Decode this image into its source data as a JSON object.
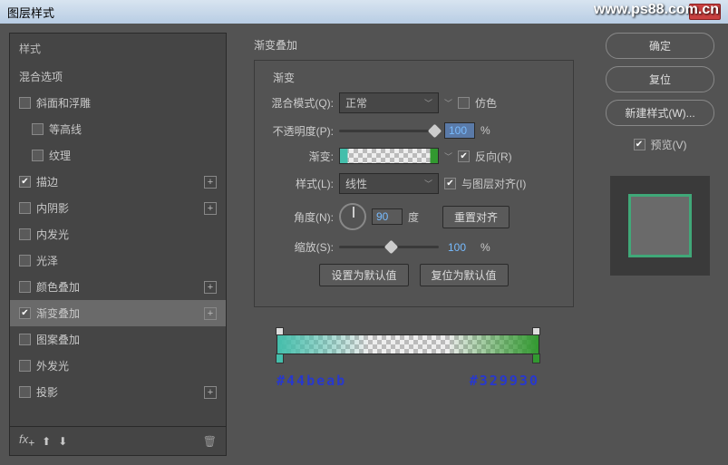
{
  "window": {
    "title": "图层样式"
  },
  "watermark": "www.ps88.com.cn",
  "sidebar": {
    "header": "样式",
    "blend_header": "混合选项",
    "items": [
      {
        "label": "斜面和浮雕",
        "checked": false,
        "sub": false,
        "plus": false
      },
      {
        "label": "等高线",
        "checked": false,
        "sub": true,
        "plus": false
      },
      {
        "label": "纹理",
        "checked": false,
        "sub": true,
        "plus": false
      },
      {
        "label": "描边",
        "checked": true,
        "sub": false,
        "plus": true
      },
      {
        "label": "内阴影",
        "checked": false,
        "sub": false,
        "plus": true
      },
      {
        "label": "内发光",
        "checked": false,
        "sub": false,
        "plus": false
      },
      {
        "label": "光泽",
        "checked": false,
        "sub": false,
        "plus": false
      },
      {
        "label": "颜色叠加",
        "checked": false,
        "sub": false,
        "plus": true
      },
      {
        "label": "渐变叠加",
        "checked": true,
        "sub": false,
        "plus": true,
        "selected": true
      },
      {
        "label": "图案叠加",
        "checked": false,
        "sub": false,
        "plus": false
      },
      {
        "label": "外发光",
        "checked": false,
        "sub": false,
        "plus": false
      },
      {
        "label": "投影",
        "checked": false,
        "sub": false,
        "plus": true
      }
    ]
  },
  "panel": {
    "title": "渐变叠加",
    "group_label": "渐变",
    "blend_mode_label": "混合模式(Q):",
    "blend_mode_value": "正常",
    "dither_label": "仿色",
    "opacity_label": "不透明度(P):",
    "opacity_value": "100",
    "pct": "%",
    "gradient_label": "渐变:",
    "reverse_label": "反向(R)",
    "style_label": "样式(L):",
    "style_value": "线性",
    "align_label": "与图层对齐(I)",
    "angle_label": "角度(N):",
    "angle_value": "90",
    "degree": "度",
    "reset_align": "重置对齐",
    "scale_label": "缩放(S):",
    "scale_value": "100",
    "set_default": "设置为默认值",
    "reset_default": "复位为默认值",
    "hex_left": "#44beab",
    "hex_right": "#329930"
  },
  "buttons": {
    "ok": "确定",
    "reset": "复位",
    "new_style": "新建样式(W)...",
    "preview": "预览(V)"
  },
  "chart_data": {
    "type": "gradient",
    "stops": [
      {
        "position": 0,
        "color": "#44beab"
      },
      {
        "position": 100,
        "color": "#329930"
      }
    ],
    "opacity": 100,
    "angle": 90,
    "scale": 100,
    "style": "线性",
    "reverse": true,
    "align": true
  }
}
